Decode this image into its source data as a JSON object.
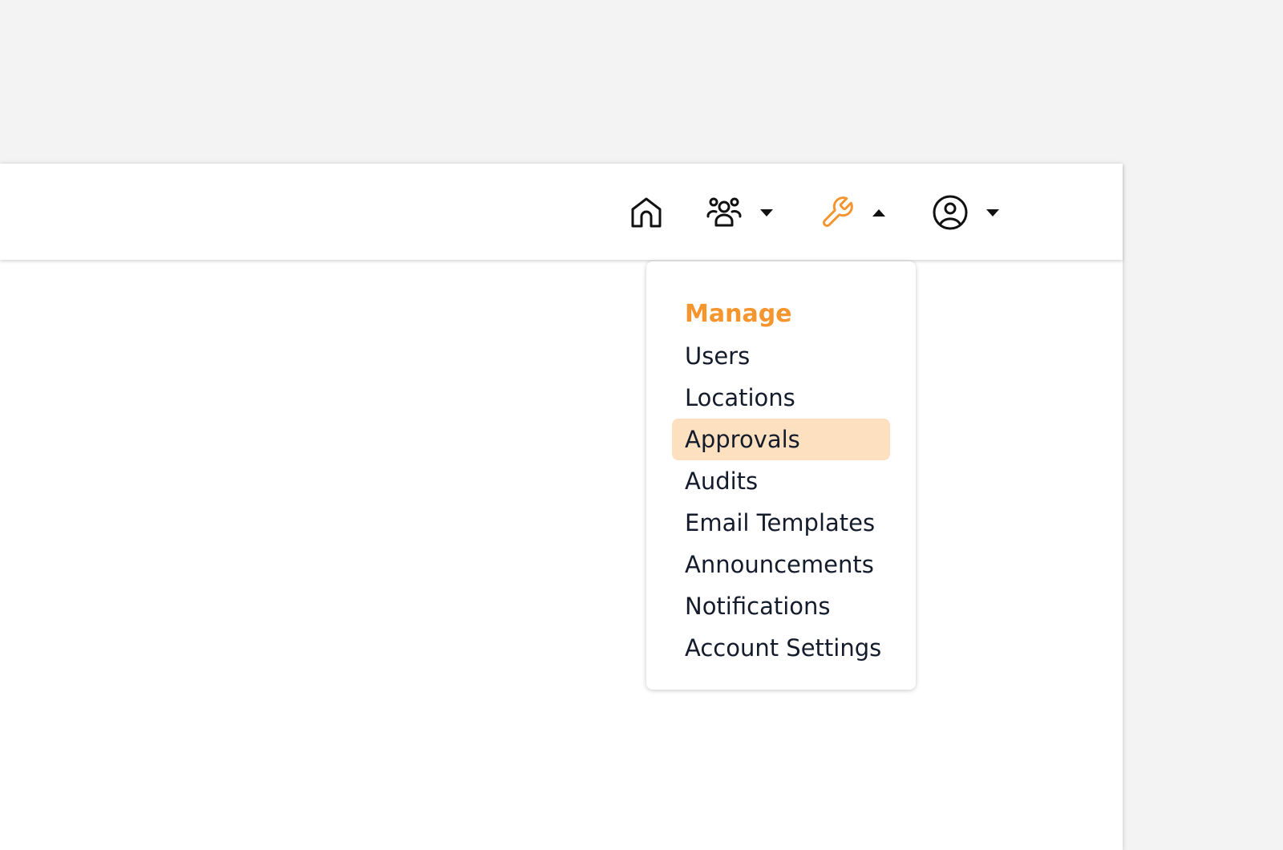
{
  "colors": {
    "accent": "#f4952e",
    "highlight": "#fde0bf",
    "text": "#141c2c",
    "page_background": "#f3f3f3"
  },
  "nav": {
    "items": [
      {
        "icon": "home-icon",
        "caret": "none"
      },
      {
        "icon": "users-group-icon",
        "caret": "down"
      },
      {
        "icon": "wrench-icon",
        "caret": "up",
        "active": true
      },
      {
        "icon": "account-circle-icon",
        "caret": "down"
      }
    ]
  },
  "manage_menu": {
    "heading": "Manage",
    "items": [
      {
        "label": "Users"
      },
      {
        "label": "Locations"
      },
      {
        "label": "Approvals",
        "highlighted": true
      },
      {
        "label": "Audits"
      },
      {
        "label": "Email Templates"
      },
      {
        "label": "Announcements"
      },
      {
        "label": "Notifications"
      },
      {
        "label": "Account Settings"
      }
    ]
  }
}
